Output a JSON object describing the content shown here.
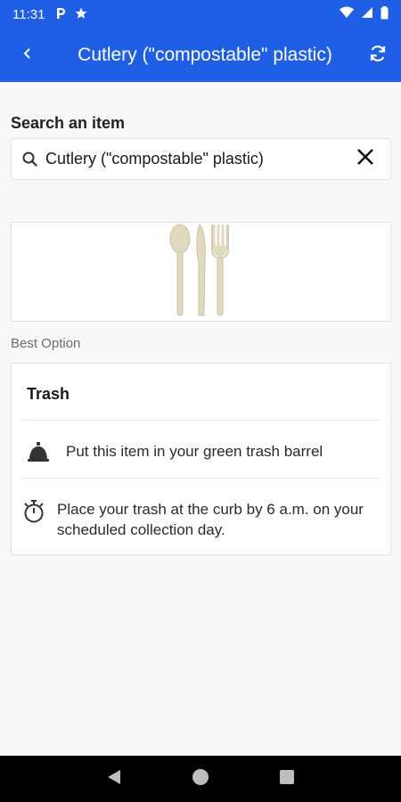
{
  "status_bar": {
    "time": "11:31",
    "left_icons": [
      "parking-notification-icon",
      "star-icon"
    ],
    "right_icons": [
      "wifi-icon",
      "signal-icon",
      "battery-icon"
    ]
  },
  "app_bar": {
    "title": "Cutlery (\"compostable\" plastic)",
    "back_icon": "chevron-left-icon",
    "refresh_icon": "refresh-icon",
    "color": "#1e5fe6"
  },
  "search": {
    "label": "Search an item",
    "value": "Cutlery (\"compostable\" plastic)",
    "search_icon": "search-icon",
    "clear_icon": "close-icon"
  },
  "item_image": {
    "icon": "cutlery-image"
  },
  "best_option": {
    "label": "Best Option",
    "title": "Trash",
    "instructions": [
      {
        "icon": "trash-barrel-icon",
        "text": "Put this item in your green trash barrel"
      },
      {
        "icon": "stopwatch-icon",
        "text": "Place your trash at the curb by 6 a.m. on your scheduled collection day."
      }
    ]
  },
  "nav_bar": {
    "buttons": [
      "back-triangle-icon",
      "home-circle-icon",
      "recents-square-icon"
    ]
  }
}
